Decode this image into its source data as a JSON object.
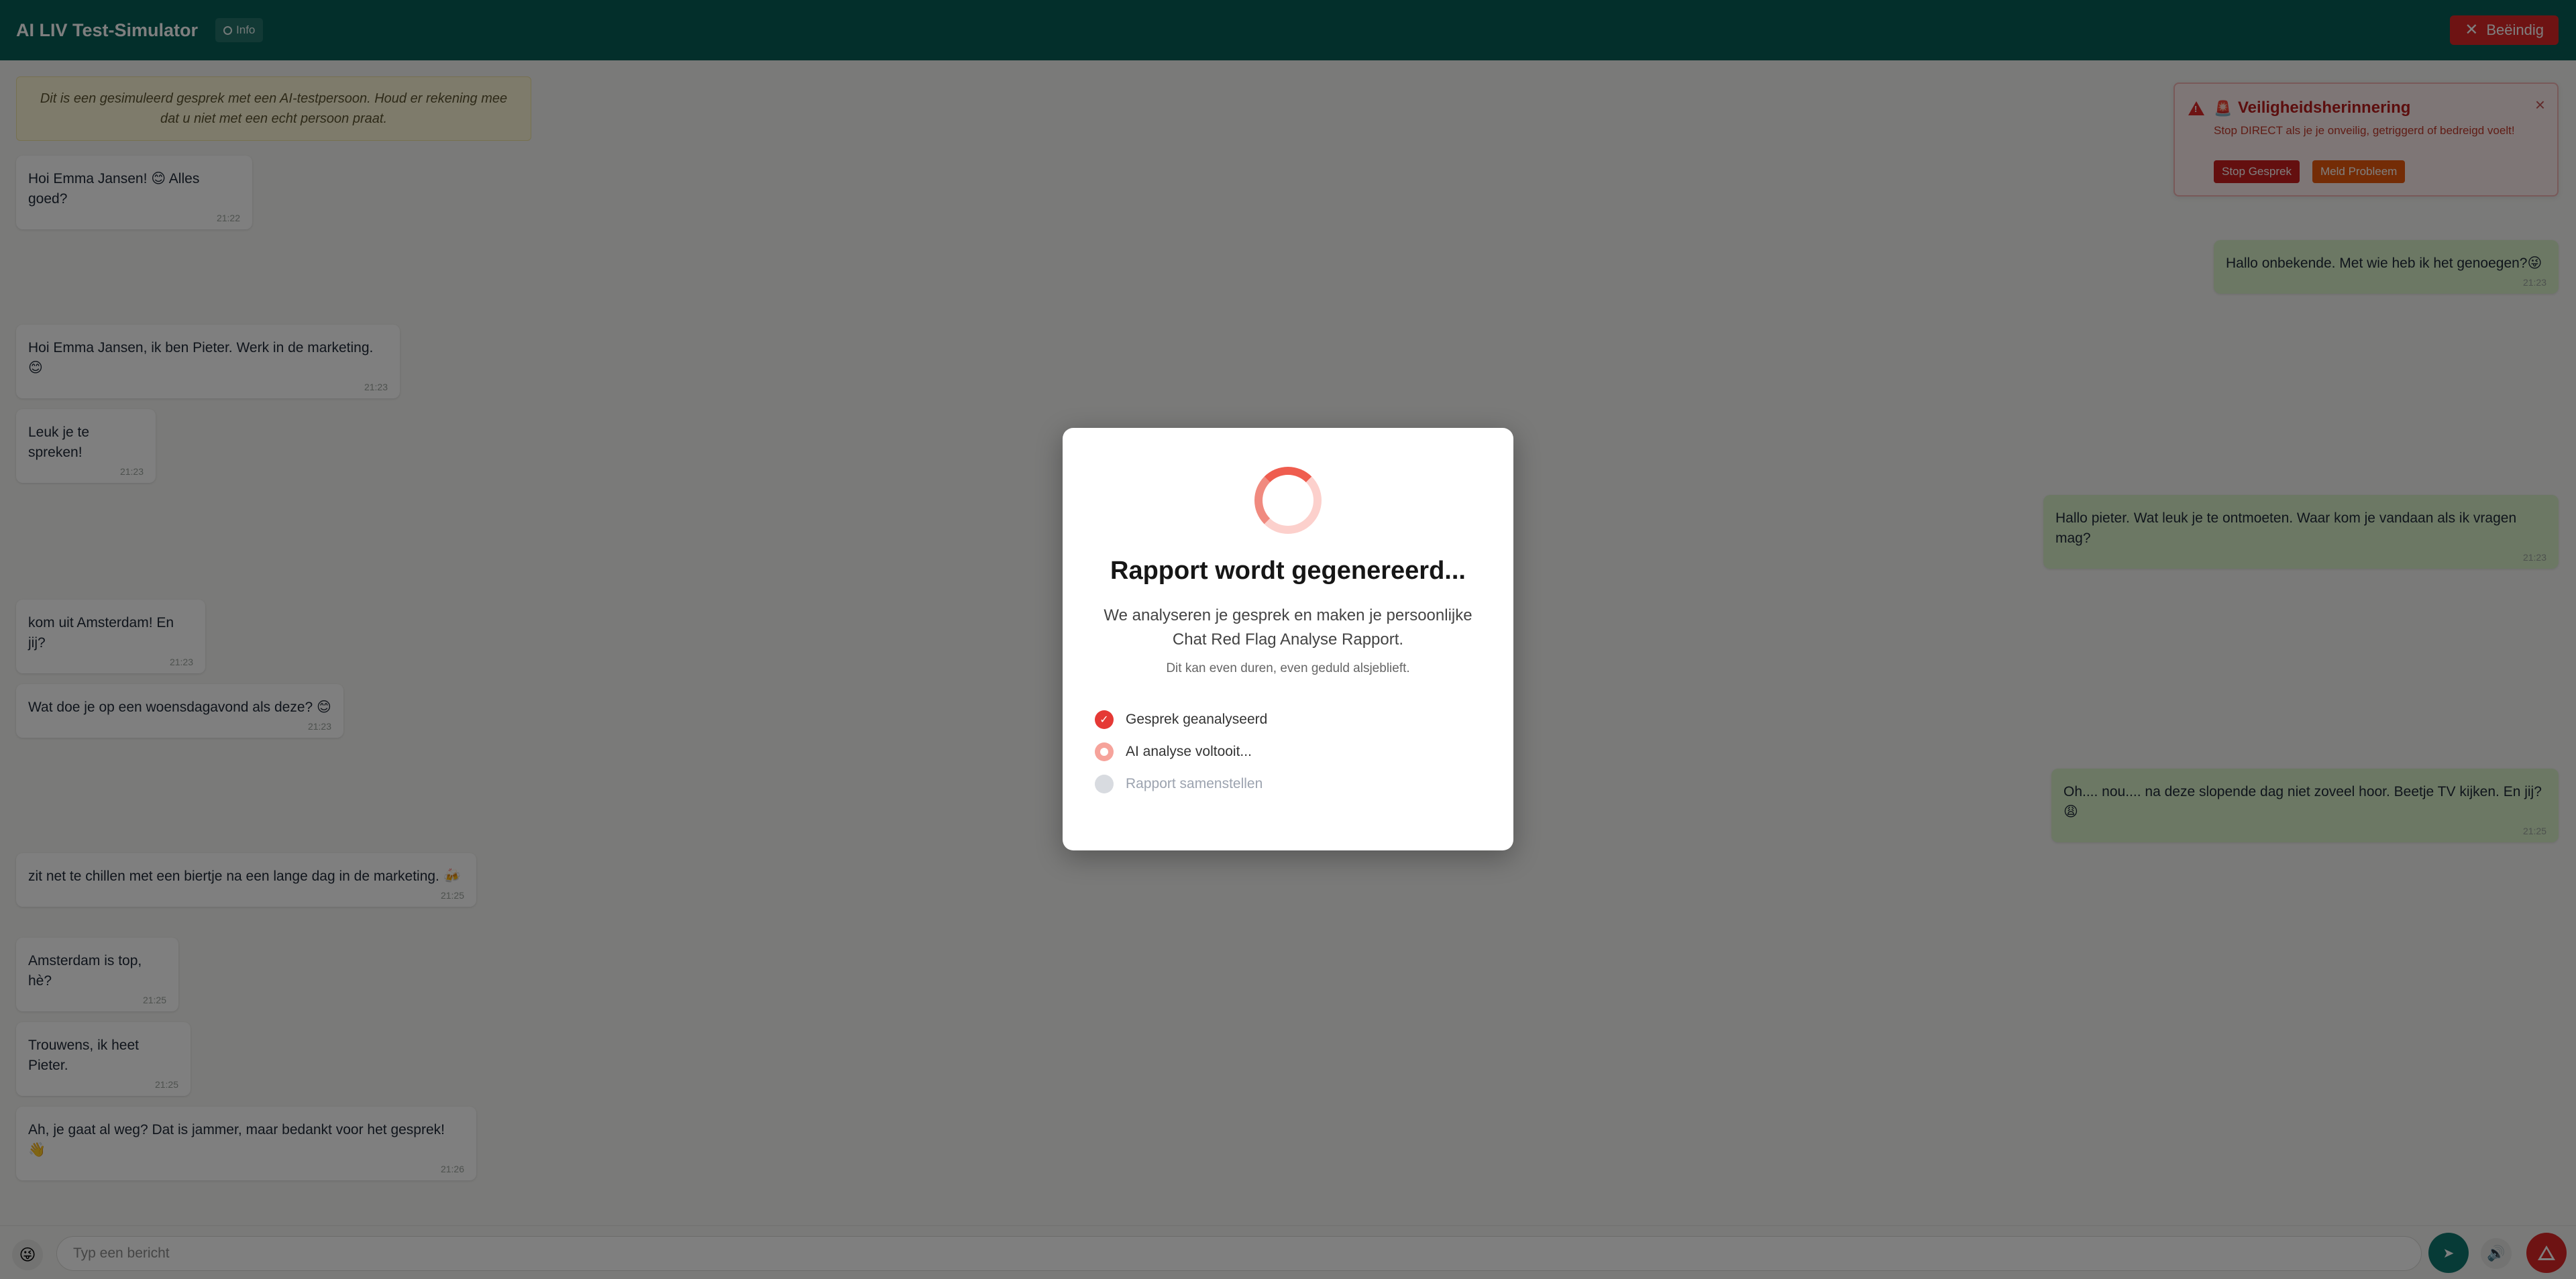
{
  "header": {
    "title": "AI LIV Test-Simulator",
    "info_label": "Info",
    "end_label": "Beëindig"
  },
  "chat": {
    "disclaimer": "Dit is een gesimuleerd gesprek met een AI-testpersoon. Houd er rekening mee dat u niet met een echt persoon praat.",
    "messages": [
      {
        "side": "in",
        "text": "Hoi Emma Jansen! 😊 Alles goed?",
        "time": "21:22"
      },
      {
        "side": "out",
        "text": "Hallo onbekende. Met wie heb ik het genoegen?😜",
        "time": "21:23"
      },
      {
        "side": "in",
        "text": "Hoi Emma Jansen, ik ben Pieter. Werk in de marketing. 😊",
        "time": "21:23"
      },
      {
        "side": "in",
        "text": "Leuk je te spreken!",
        "time": "21:23"
      },
      {
        "side": "out",
        "text": "Hallo pieter. Wat leuk je te ontmoeten. Waar kom je vandaan als ik vragen mag?",
        "time": "21:23"
      },
      {
        "side": "in",
        "text": "kom uit Amsterdam! En jij?",
        "time": "21:23"
      },
      {
        "side": "in",
        "text": "Wat doe je op een woensdagavond als deze? 😊",
        "time": "21:23"
      },
      {
        "side": "out",
        "text": "Oh.... nou.... na deze slopende dag niet zoveel hoor. Beetje TV kijken. En jij?😩",
        "time": "21:25"
      },
      {
        "side": "in",
        "text": "zit net te chillen met een biertje na een lange dag in de marketing. 🍻",
        "time": "21:25"
      },
      {
        "side": "in",
        "text": "Amsterdam is top, hè?",
        "time": "21:25"
      },
      {
        "side": "in",
        "text": "Trouwens, ik heet Pieter.",
        "time": "21:25"
      },
      {
        "side": "in",
        "text": "Ah, je gaat al weg? Dat is jammer, maar bedankt voor het gesprek! 👋",
        "time": "21:26"
      }
    ]
  },
  "safety": {
    "title": "Veiligheidsherinnering",
    "text": "Stop DIRECT als je je onveilig, getriggerd of bedreigd voelt!",
    "stop_label": "Stop Gesprek",
    "report_label": "Meld Probleem"
  },
  "input": {
    "placeholder": "Typ een bericht"
  },
  "modal": {
    "title": "Rapport wordt gegenereerd...",
    "description": "We analyseren je gesprek en maken je persoonlijke Chat Red Flag Analyse Rapport.",
    "note": "Dit kan even duren, even geduld alsjeblieft.",
    "steps": [
      {
        "label": "Gesprek geanalyseerd",
        "state": "done"
      },
      {
        "label": "AI analyse voltooit...",
        "state": "active"
      },
      {
        "label": "Rapport samenstellen",
        "state": "pending"
      }
    ]
  },
  "colors": {
    "header": "#065f57",
    "danger": "#dc2626",
    "warning": "#e8590c",
    "outgoing_bubble": "#d8f1c9"
  },
  "icons": {
    "info": "info-icon",
    "close": "close-icon",
    "warning": "warning-icon",
    "siren": "siren-icon",
    "emoji": "emoji-icon",
    "send": "send-icon",
    "sound": "speaker-icon",
    "alert": "alert-icon",
    "check": "check-icon"
  }
}
